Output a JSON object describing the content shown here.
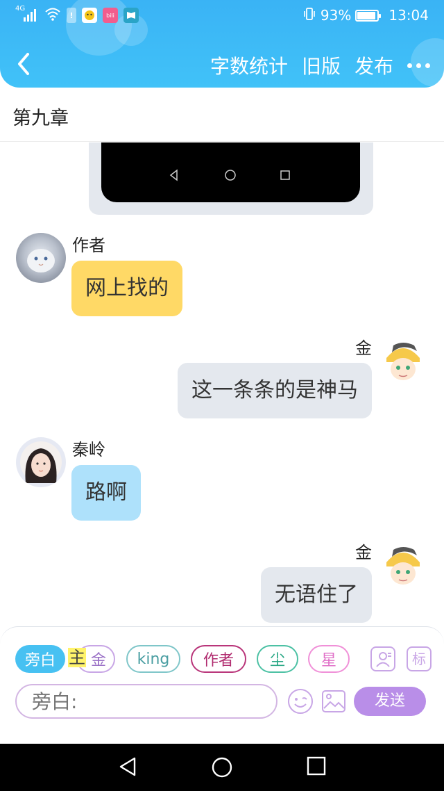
{
  "status_bar": {
    "signal_label": "4G",
    "battery_percent": "93%",
    "time": "13:04",
    "battery_level": 0.93,
    "icons": [
      "signal-icon",
      "wifi-icon",
      "alert-icon",
      "bilibili-app-icon",
      "reader-app-icon"
    ]
  },
  "header": {
    "back_icon": "chevron-left-icon",
    "actions": {
      "word_count": "字数统计",
      "old_version": "旧版",
      "publish": "发布"
    },
    "more_icon": "more-dots-icon",
    "accent_color": "#3ab3f5"
  },
  "chapter": {
    "title": "第九章"
  },
  "messages": [
    {
      "sender": "作者",
      "text": "网上找的",
      "side": "left",
      "bubble_color": "#ffd966"
    },
    {
      "sender": "金",
      "text": "这一条条的是神马",
      "side": "right",
      "bubble_color": "#e4e8ee"
    },
    {
      "sender": "秦岭",
      "text": "路啊",
      "side": "left",
      "bubble_color": "#aee1fb"
    },
    {
      "sender": "金",
      "text": "无语住了",
      "side": "right",
      "bubble_color": "#e4e8ee"
    }
  ],
  "role_chips": [
    {
      "label": "旁白",
      "selected": true
    },
    {
      "label": "金",
      "highlight_prefix": "主"
    },
    {
      "label": "king"
    },
    {
      "label": "作者"
    },
    {
      "label": "尘"
    },
    {
      "label": "星"
    }
  ],
  "panel_icons": {
    "role_manage": "person-card-icon",
    "tag": "标",
    "emoji": "emoji-icon",
    "image": "image-icon"
  },
  "input": {
    "placeholder": "旁白:",
    "value": ""
  },
  "send_label": "发送"
}
